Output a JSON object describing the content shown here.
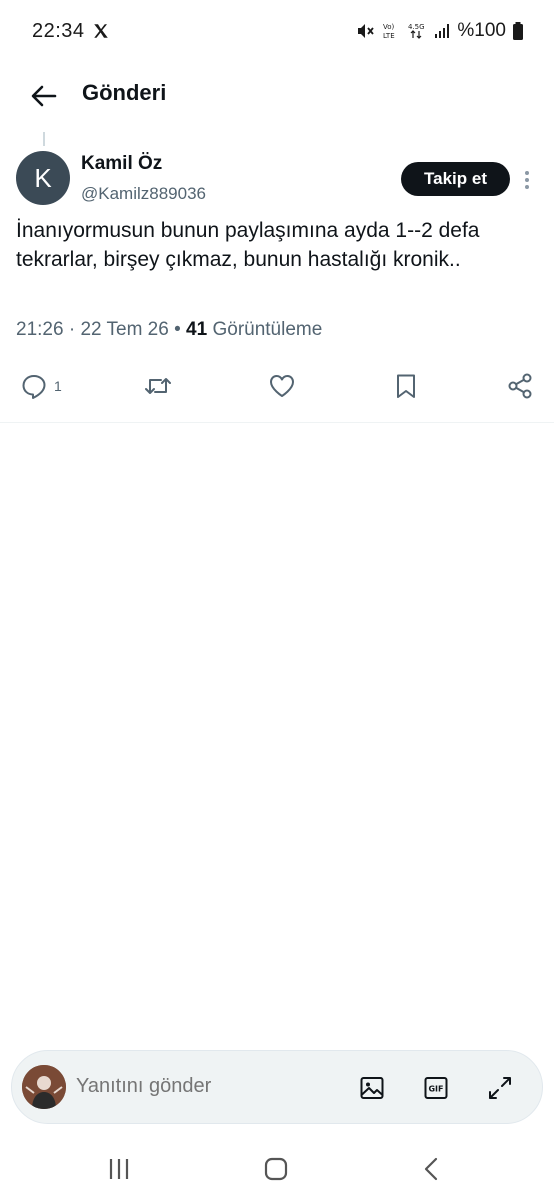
{
  "status_bar": {
    "time": "22:34",
    "battery_text": "%100",
    "icons": [
      "x-logo-icon",
      "mute-icon",
      "volte-icon",
      "4-5g-icon",
      "signal-icon",
      "battery-icon"
    ]
  },
  "header": {
    "title": "Gönderi",
    "back_icon": "arrow-left-icon"
  },
  "tweet": {
    "avatar_letter": "K",
    "author_name": "Kamil Öz",
    "author_handle": "@Kamilz889036",
    "follow_label": "Takip et",
    "text": "İnanıyormusun bunun paylaşımına ayda 1--2 defa tekrarlar, birşey çıkmaz, bunun hastalığı kronik..",
    "meta_time": "21:26",
    "meta_date": "22 Tem 26",
    "separator": "·",
    "separator_bullet": "•",
    "views_count": "41",
    "views_label": "Görüntüleme",
    "reply_count": "1"
  },
  "actions": [
    "reply-icon",
    "retweet-icon",
    "like-icon",
    "bookmark-icon",
    "share-icon"
  ],
  "reply_bar": {
    "placeholder": "Yanıtını gönder",
    "icons": [
      "image-icon",
      "gif-icon",
      "expand-icon"
    ]
  },
  "colors": {
    "text_primary": "#0f1419",
    "text_secondary": "#536471",
    "avatar_bg": "#3b4a56",
    "follow_bg": "#0f1419"
  }
}
